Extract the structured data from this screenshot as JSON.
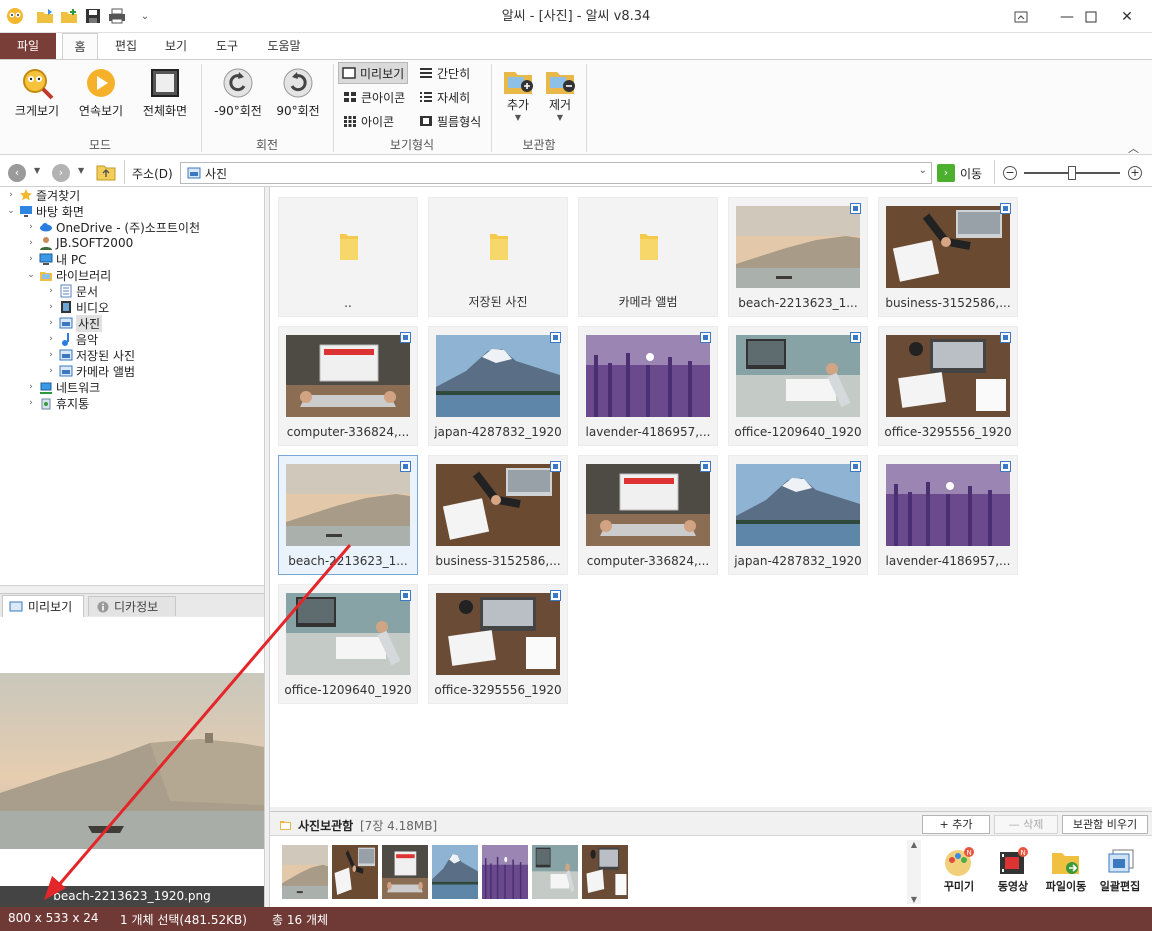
{
  "window": {
    "title": "알씨 - [사진] - 알씨 v8.34"
  },
  "ribbon_tabs": [
    "파일",
    "홈",
    "편집",
    "보기",
    "도구",
    "도움말"
  ],
  "ribbon": {
    "mode": {
      "group": "모드",
      "buttons": [
        "크게보기",
        "연속보기",
        "전체화면"
      ]
    },
    "rotate": {
      "group": "회전",
      "buttons": [
        "-90°회전",
        "90°회전"
      ]
    },
    "view": {
      "group": "보기형식",
      "items": [
        "미리보기",
        "간단히",
        "큰아이콘",
        "자세히",
        "아이콘",
        "필름형식"
      ]
    },
    "storage": {
      "group": "보관함",
      "buttons": [
        "추가",
        "제거"
      ]
    }
  },
  "address": {
    "label": "주소(D)",
    "value": "사진",
    "go": "이동"
  },
  "tree": [
    {
      "label": "즐겨찾기",
      "level": 0,
      "expander": "›",
      "icon": "star-icon"
    },
    {
      "label": "바탕 화면",
      "level": 0,
      "expander": "⌄",
      "icon": "desktop-icon"
    },
    {
      "label": "OneDrive - (주)소프트이천",
      "level": 1,
      "expander": "›",
      "icon": "cloud-icon"
    },
    {
      "label": "JB.SOFT2000",
      "level": 1,
      "expander": "›",
      "icon": "user-icon"
    },
    {
      "label": "내 PC",
      "level": 1,
      "expander": "›",
      "icon": "pc-icon"
    },
    {
      "label": "라이브러리",
      "level": 1,
      "expander": "⌄",
      "icon": "library-icon"
    },
    {
      "label": "문서",
      "level": 2,
      "expander": "›",
      "icon": "document-icon"
    },
    {
      "label": "비디오",
      "level": 2,
      "expander": "›",
      "icon": "video-icon"
    },
    {
      "label": "사진",
      "level": 2,
      "expander": "›",
      "icon": "picture-icon"
    },
    {
      "label": "음악",
      "level": 2,
      "expander": "›",
      "icon": "music-icon"
    },
    {
      "label": "저장된 사진",
      "level": 2,
      "expander": "›",
      "icon": "picture-icon"
    },
    {
      "label": "카메라 앨범",
      "level": 2,
      "expander": "›",
      "icon": "picture-icon"
    },
    {
      "label": "네트워크",
      "level": 1,
      "expander": "›",
      "icon": "network-icon"
    },
    {
      "label": "휴지통",
      "level": 1,
      "expander": "›",
      "icon": "trash-icon"
    }
  ],
  "preview": {
    "tabs": [
      "미리보기",
      "디카정보"
    ],
    "filename": "beach-2213623_1920.png"
  },
  "files": [
    {
      "name": "..",
      "kind": "folder"
    },
    {
      "name": "저장된 사진",
      "kind": "folder"
    },
    {
      "name": "카메라 앨범",
      "kind": "folder"
    },
    {
      "name": "beach-2213623_1...",
      "kind": "beach"
    },
    {
      "name": "business-3152586,...",
      "kind": "business"
    },
    {
      "name": "computer-336824,...",
      "kind": "computer"
    },
    {
      "name": "japan-4287832_1920",
      "kind": "japan"
    },
    {
      "name": "lavender-4186957,...",
      "kind": "lavender"
    },
    {
      "name": "office-1209640_1920",
      "kind": "office1"
    },
    {
      "name": "office-3295556_1920",
      "kind": "office2"
    },
    {
      "name": "beach-2213623_1...",
      "kind": "beach",
      "selected": true
    },
    {
      "name": "business-3152586,...",
      "kind": "business"
    },
    {
      "name": "computer-336824,...",
      "kind": "computer"
    },
    {
      "name": "japan-4287832_1920",
      "kind": "japan"
    },
    {
      "name": "lavender-4186957,...",
      "kind": "lavender"
    },
    {
      "name": "office-1209640_1920",
      "kind": "office1"
    },
    {
      "name": "office-3295556_1920",
      "kind": "office2"
    }
  ],
  "photobox": {
    "title": "사진보관함",
    "count": "[7장 4.18MB]",
    "add": "+ 추가",
    "delete": "— 삭제",
    "empty": "보관함 비우기",
    "thumbs": [
      "beach",
      "business",
      "computer",
      "japan",
      "lavender",
      "office1",
      "office2"
    ],
    "tools": [
      "꾸미기",
      "동영상",
      "파일이동",
      "일괄편집"
    ],
    "new_badge": "N"
  },
  "status": {
    "dimensions": "800 x 533 x 24",
    "selection": "1 개체 선택(481.52KB)",
    "total": "총 16 개체"
  },
  "colors": {
    "accent": "#7a3e39",
    "status_bar": "#6f3a36",
    "selection": "#7aa8d8"
  }
}
